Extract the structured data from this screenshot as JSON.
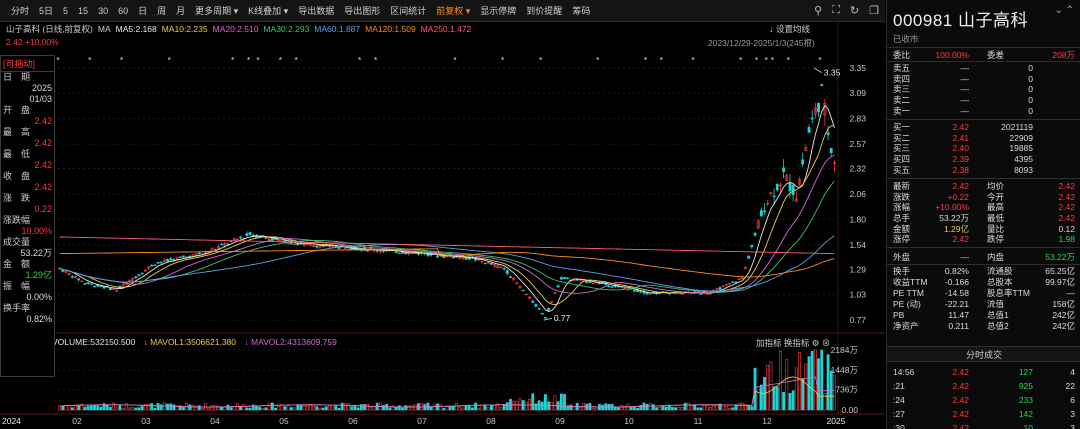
{
  "toolbar": {
    "items": [
      "分时",
      "5日",
      "5",
      "15",
      "30",
      "60",
      "日",
      "周",
      "月",
      "更多周期",
      "K线叠加",
      "导出数据",
      "导出图形",
      "区间统计",
      "前复权",
      "显示停牌",
      "到价提醒",
      "筹码"
    ],
    "active_index": 14
  },
  "ma_line": {
    "title": "山子高科 (日线,前复权)",
    "ma_label": "MA",
    "ma5": "MA5:2.168",
    "ma10": "MA10:2.235",
    "ma20": "MA20:2.510",
    "ma30": "MA30:2.293",
    "ma60": "MA60:1.887",
    "ma120": "MA120:1.509",
    "ma250": "MA250:1.472"
  },
  "sub_line": "2.42 +10.00%",
  "date_range": "2023/12/29-2025/1/3(245根)",
  "settings_label": "设置均线",
  "info_panel": {
    "title": "[可拖动]",
    "rows": [
      {
        "label": "日　期",
        "value": "2025"
      },
      {
        "label": "",
        "value": "01/03"
      },
      {
        "label": "开　盘",
        "value": "2.42"
      },
      {
        "label": "最　高",
        "value": "2.42"
      },
      {
        "label": "最　低",
        "value": "2.42"
      },
      {
        "label": "收　盘",
        "value": "2.42"
      },
      {
        "label": "涨　跌",
        "value": "0.22"
      },
      {
        "label": "涨跌幅",
        "value": "10.00%"
      },
      {
        "label": "成交量",
        "value": "53.22万"
      },
      {
        "label": "金　额",
        "value": "1.29亿"
      },
      {
        "label": "振　幅",
        "value": "0.00%"
      },
      {
        "label": "换手率",
        "value": "0.82%"
      }
    ]
  },
  "chart_data": {
    "type": "candlestick",
    "x_ticks": [
      "2024",
      "02",
      "03",
      "04",
      "05",
      "06",
      "07",
      "08",
      "09",
      "10",
      "11",
      "12",
      "2025"
    ],
    "y_ticks": [
      3.35,
      3.09,
      2.83,
      2.57,
      2.32,
      2.06,
      1.8,
      1.54,
      1.29,
      1.03,
      0.77
    ],
    "ylim": [
      0.72,
      3.45
    ],
    "annotations": [
      {
        "text": "3.35",
        "value": 3.35
      },
      {
        "text": "0.77",
        "value": 0.77
      }
    ],
    "max_price": 3.35,
    "min_price": 0.77,
    "ma_colors": {
      "ma5": "#e8e8e8",
      "ma10": "#e8d14a",
      "ma20": "#d46bd4",
      "ma30": "#3cc46a",
      "ma60": "#5aa0e6",
      "ma120": "#ff8c1a",
      "ma250": "#ff5a7a"
    },
    "volume_ticks": [
      "2184万",
      "1448万",
      "736万",
      "0.00"
    ],
    "volume_ylim": [
      0,
      2250
    ],
    "volume_legend": {
      "vol": "VOLUME:532150.500",
      "mavol1": "↓ MAVOL1:3506621.380",
      "mavol2": "↓ MAVOL2:4313609.759"
    },
    "volume_tools": "加指标 换指标"
  },
  "right_panel": {
    "code_name": "000981 山子高科",
    "status": "已收市",
    "webi": {
      "label": "委比",
      "value": "100.00%",
      "label2": "委差",
      "value2": "208万"
    },
    "sells": [
      {
        "label": "卖五",
        "price": "—",
        "vol": "0"
      },
      {
        "label": "卖四",
        "price": "—",
        "vol": "0"
      },
      {
        "label": "卖三",
        "price": "—",
        "vol": "0"
      },
      {
        "label": "卖二",
        "price": "—",
        "vol": "0"
      },
      {
        "label": "卖一",
        "price": "—",
        "vol": "0"
      }
    ],
    "buys": [
      {
        "label": "买一",
        "price": "2.42",
        "vol": "2021119"
      },
      {
        "label": "买二",
        "price": "2.41",
        "vol": "22909"
      },
      {
        "label": "买三",
        "price": "2.40",
        "vol": "19885"
      },
      {
        "label": "买四",
        "price": "2.39",
        "vol": "4395"
      },
      {
        "label": "买五",
        "price": "2.38",
        "vol": "8093"
      }
    ],
    "stats": [
      {
        "l1": "最新",
        "v1": "2.42",
        "c1": "red",
        "l2": "均价",
        "v2": "2.42",
        "c2": "red"
      },
      {
        "l1": "涨跌",
        "v1": "+0.22",
        "c1": "red",
        "l2": "今开",
        "v2": "2.42",
        "c2": "red"
      },
      {
        "l1": "涨幅",
        "v1": "+10.00%",
        "c1": "red",
        "l2": "最高",
        "v2": "2.42",
        "c2": "red"
      },
      {
        "l1": "总手",
        "v1": "53.22万",
        "c1": "white",
        "l2": "最低",
        "v2": "2.42",
        "c2": "red"
      },
      {
        "l1": "金额",
        "v1": "1.29亿",
        "c1": "yellow",
        "l2": "量比",
        "v2": "0.12",
        "c2": "white"
      },
      {
        "l1": "涨停",
        "v1": "2.42",
        "c1": "red",
        "l2": "跌停",
        "v2": "1.98",
        "c2": "green"
      }
    ],
    "outer_inner": {
      "l1": "外盘",
      "v1": "—",
      "l2": "内盘",
      "v2": "53.22万"
    },
    "fundamentals": [
      {
        "l1": "换手",
        "v1": "0.82%",
        "l2": "流通股",
        "v2": "65.25亿"
      },
      {
        "l1": "收益TTM",
        "v1": "-0.166",
        "l2": "总股本",
        "v2": "99.97亿"
      },
      {
        "l1": "PE TTM",
        "v1": "-14.58",
        "l2": "股息率TTM",
        "v2": "—"
      },
      {
        "l1": "PE (动)",
        "v1": "-22.21",
        "l2": "流值",
        "v2": "158亿"
      },
      {
        "l1": "PB",
        "v1": "11.47",
        "l2": "总值1",
        "v2": "242亿"
      },
      {
        "l1": "净资产",
        "v1": "0.211",
        "l2": "总值2",
        "v2": "242亿"
      }
    ],
    "ticks_title": "分时成交",
    "ticks": [
      {
        "time": "14:56",
        "price": "2.42",
        "vol": "127",
        "num": "4"
      },
      {
        "time": ":21",
        "price": "2.42",
        "vol": "925",
        "num": "22"
      },
      {
        "time": ":24",
        "price": "2.42",
        "vol": "233",
        "num": "6"
      },
      {
        "time": ":27",
        "price": "2.42",
        "vol": "142",
        "num": "3"
      },
      {
        "time": ":30",
        "price": "2.42",
        "vol": "10",
        "num": "3"
      }
    ]
  }
}
